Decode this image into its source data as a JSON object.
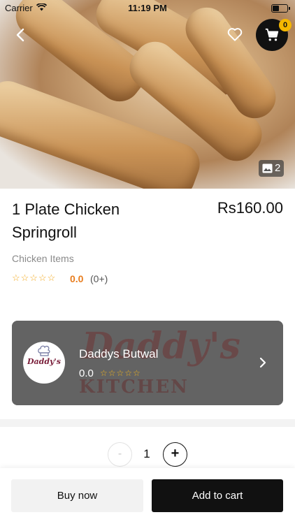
{
  "status_bar": {
    "carrier": "Carrier",
    "time": "11:19 PM"
  },
  "header": {
    "cart_count": "0",
    "image_count": "2"
  },
  "product": {
    "name": "1 Plate Chicken Springroll",
    "price": "Rs160.00",
    "category": "Chicken Items",
    "rating_stars": "☆☆☆☆☆",
    "rating_value": "0.0",
    "rating_count": "(0+)"
  },
  "restaurant": {
    "name": "Daddys Butwal",
    "rating_value": "0.0",
    "rating_stars": "☆☆☆☆☆",
    "logo_text": "Daddy's",
    "banner_text": "Daddy's",
    "banner_subtext": "KITCHEN"
  },
  "quantity": {
    "minus_label": "-",
    "value": "1",
    "plus_label": "+"
  },
  "actions": {
    "buy_now": "Buy now",
    "add_to_cart": "Add to cart"
  },
  "colors": {
    "accent": "#111111",
    "badge": "#f5b800",
    "star": "#f2a81d",
    "rating": "#e87d1e"
  },
  "icons": [
    "back-arrow-icon",
    "heart-icon",
    "cart-icon",
    "image-icon",
    "chevron-right-icon",
    "star-icon"
  ]
}
